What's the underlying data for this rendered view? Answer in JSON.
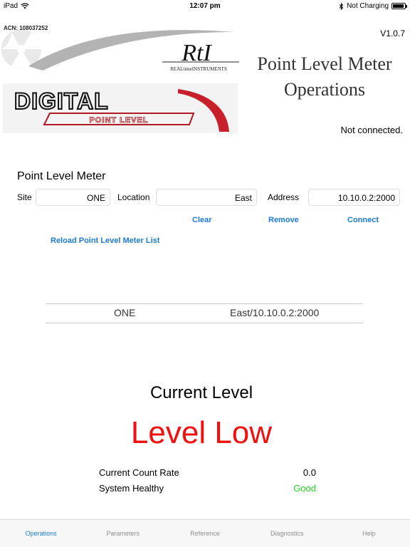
{
  "statusbar": {
    "device": "iPad",
    "time": "12:07 pm",
    "charging": "Not Charging"
  },
  "header": {
    "acn": "ACN: 108037252",
    "version": "V1.0.7",
    "brand_logo_text": "RtI",
    "brand_subtitle": "REALtimeINSTRUMENTS",
    "product_logo_text": "DIGITAL",
    "product_logo_subtext": "POINT LEVEL",
    "title_line1": "Point Level Meter",
    "title_line2": "Operations",
    "connection_status": "Not connected."
  },
  "meter": {
    "section_title": "Point Level Meter",
    "site_label": "Site",
    "site_value": "ONE",
    "location_label": "Location",
    "location_value": "East",
    "address_label": "Address",
    "address_value": "10.10.0.2:2000",
    "clear_label": "Clear",
    "remove_label": "Remove",
    "connect_label": "Connect",
    "reload_label": "Reload Point Level Meter List",
    "list": [
      {
        "site": "ONE",
        "location_address": "East/10.10.0.2:2000"
      }
    ]
  },
  "status": {
    "current_level_label": "Current Level",
    "level_value": "Level Low",
    "count_rate_label": "Current Count Rate",
    "count_rate_value": "0.0",
    "healthy_label": "System Healthy",
    "healthy_value": "Good",
    "colors": {
      "level_low": "#f01010",
      "good": "#22d622",
      "accent": "#1a7ad6"
    }
  },
  "tabs": [
    {
      "label": "Operations",
      "active": true
    },
    {
      "label": "Parameters",
      "active": false
    },
    {
      "label": "Reference",
      "active": false
    },
    {
      "label": "Diagnostics",
      "active": false
    },
    {
      "label": "Help",
      "active": false
    }
  ]
}
